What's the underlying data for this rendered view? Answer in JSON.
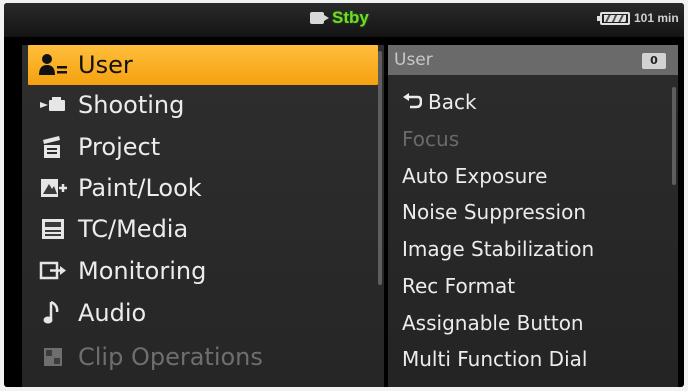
{
  "status_bar": {
    "status": "Stby",
    "status_color": "#6fdc28",
    "battery_text": "101 min",
    "camera_icon": "camera-icon",
    "battery_icon": "battery-icon"
  },
  "left_menu": {
    "items": [
      {
        "label": "User",
        "icon": "user-icon",
        "selected": true,
        "enabled": true
      },
      {
        "label": "Shooting",
        "icon": "camera-record-icon",
        "selected": false,
        "enabled": true
      },
      {
        "label": "Project",
        "icon": "clapperboard-icon",
        "selected": false,
        "enabled": true
      },
      {
        "label": "Paint/Look",
        "icon": "paint-icon",
        "selected": false,
        "enabled": true
      },
      {
        "label": "TC/Media",
        "icon": "tc-media-icon",
        "selected": false,
        "enabled": true
      },
      {
        "label": "Monitoring",
        "icon": "monitor-output-icon",
        "selected": false,
        "enabled": true
      },
      {
        "label": "Audio",
        "icon": "music-note-icon",
        "selected": false,
        "enabled": true
      },
      {
        "label": "Clip Operations",
        "icon": "clip-grid-icon",
        "selected": false,
        "enabled": false
      }
    ]
  },
  "right_panel": {
    "header": "User",
    "page": "0",
    "items": [
      {
        "label": "Back",
        "icon": "back-arrow-icon",
        "enabled": true
      },
      {
        "label": "Focus",
        "enabled": false
      },
      {
        "label": "Auto Exposure",
        "enabled": true
      },
      {
        "label": "Noise Suppression",
        "enabled": true
      },
      {
        "label": "Image Stabilization",
        "enabled": true
      },
      {
        "label": "Rec Format",
        "enabled": true
      },
      {
        "label": "Assignable Button",
        "enabled": true
      },
      {
        "label": "Multi Function Dial",
        "enabled": true
      }
    ]
  },
  "colors": {
    "selected_bg": "#f5a10f",
    "text": "#ececec",
    "disabled_text": "#6e6e6e"
  }
}
